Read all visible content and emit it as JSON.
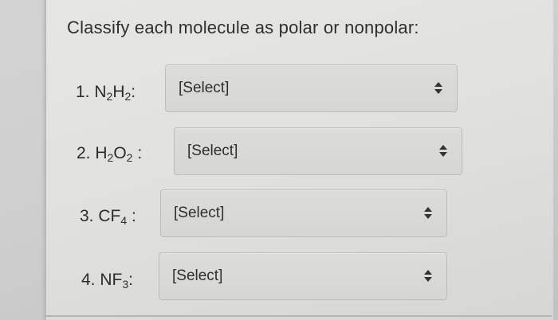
{
  "question": {
    "title": "Classify each molecule as polar or nonpolar:"
  },
  "items": [
    {
      "num": "1.",
      "formula_parts": [
        "N",
        "2",
        "H",
        "2"
      ],
      "colon": ":",
      "selected": "[Select]"
    },
    {
      "num": "2.",
      "formula_parts": [
        "H",
        "2",
        "O",
        "2"
      ],
      "colon": ":",
      "selected": "[Select]"
    },
    {
      "num": "3.",
      "formula_parts": [
        "CF",
        "4"
      ],
      "colon": ":",
      "selected": "[Select]"
    },
    {
      "num": "4.",
      "formula_parts": [
        "NF",
        "3"
      ],
      "colon": ":",
      "selected": "[Select]"
    }
  ],
  "icons": {
    "select_arrows": "up-down-arrows-icon"
  }
}
